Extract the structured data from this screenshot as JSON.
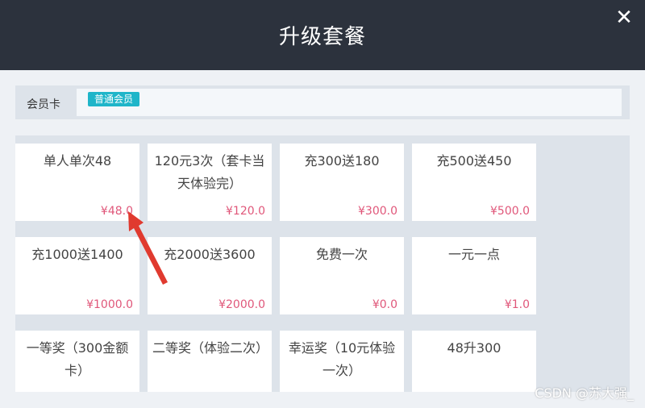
{
  "header": {
    "title": "升级套餐"
  },
  "member": {
    "label": "会员卡",
    "tag": "普通会员"
  },
  "packages": [
    {
      "name": "单人单次48",
      "price": "¥48.0"
    },
    {
      "name": "120元3次（套卡当天体验完）",
      "price": "¥120.0"
    },
    {
      "name": "充300送180",
      "price": "¥300.0"
    },
    {
      "name": "充500送450",
      "price": "¥500.0"
    },
    {
      "name": "充1000送1400",
      "price": "¥1000.0"
    },
    {
      "name": "充2000送3600",
      "price": "¥2000.0"
    },
    {
      "name": "免费一次",
      "price": "¥0.0"
    },
    {
      "name": "一元一点",
      "price": "¥1.0"
    },
    {
      "name": "一等奖（300金额卡）",
      "price": ""
    },
    {
      "name": "二等奖（体验二次）",
      "price": ""
    },
    {
      "name": "幸运奖（10元体验一次）",
      "price": ""
    },
    {
      "name": "48升300",
      "price": ""
    }
  ],
  "watermark": "CSDN @苏大强_",
  "colors": {
    "header_bg": "#2c323d",
    "tag_bg": "#1fb5c9",
    "price": "#e0577a",
    "arrow": "#e03a2f"
  },
  "icons": {
    "close": "close-icon",
    "arrow": "red-arrow-annotation"
  }
}
